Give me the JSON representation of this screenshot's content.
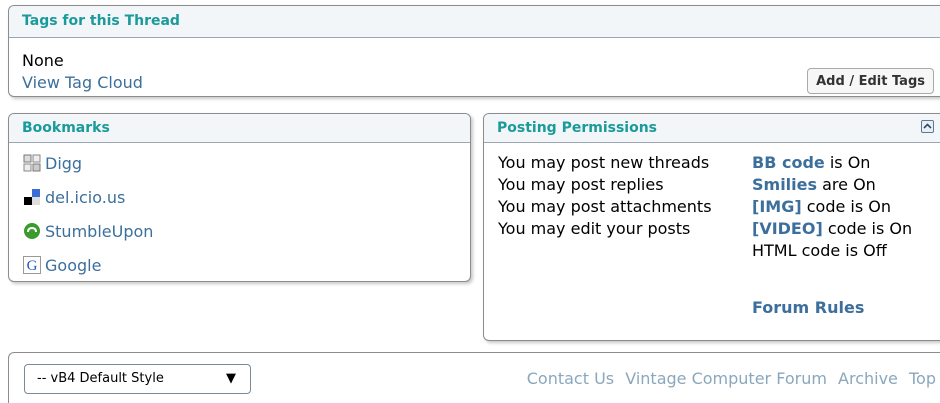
{
  "tags": {
    "title": "Tags for this Thread",
    "none_text": "None",
    "cloud_link": "View Tag Cloud",
    "edit_button": "Add / Edit Tags"
  },
  "bookmarks": {
    "title": "Bookmarks",
    "items": [
      {
        "label": "Digg",
        "icon": "digg-icon"
      },
      {
        "label": "del.icio.us",
        "icon": "delicious-icon"
      },
      {
        "label": "StumbleUpon",
        "icon": "stumbleupon-icon"
      },
      {
        "label": "Google",
        "icon": "google-icon"
      }
    ]
  },
  "permissions": {
    "title": "Posting Permissions",
    "left": [
      "You may post new threads",
      "You may post replies",
      "You may post attachments",
      "You may edit your posts"
    ],
    "right": [
      {
        "label": "BB code",
        "rest": " is On"
      },
      {
        "label": "Smilies",
        "rest": " are On"
      },
      {
        "label": "[IMG]",
        "rest": " code is On"
      },
      {
        "label": "[VIDEO]",
        "rest": " code is On"
      },
      {
        "label": "",
        "rest": "HTML code is Off"
      }
    ],
    "rules_link": "Forum Rules"
  },
  "footer": {
    "style_select": "-- vB4 Default Style",
    "links": [
      "Contact Us",
      "Vintage Computer Forum",
      "Archive",
      "Top"
    ]
  }
}
